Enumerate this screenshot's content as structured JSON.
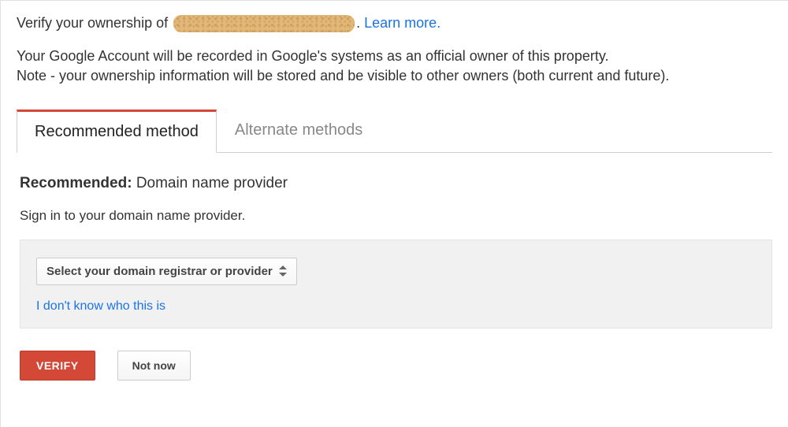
{
  "header": {
    "verify_prefix": "Verify your ownership of",
    "verify_suffix": ".",
    "learn_more": "Learn more.",
    "disclaimer_line1": "Your Google Account will be recorded in Google's systems as an official owner of this property.",
    "disclaimer_line2": "Note - your ownership information will be stored and be visible to other owners (both current and future)."
  },
  "tabs": {
    "recommended": "Recommended method",
    "alternate": "Alternate methods"
  },
  "main": {
    "recommended_label": "Recommended:",
    "method_name": "Domain name provider",
    "signin_text": "Sign in to your domain name provider.",
    "select_placeholder": "Select your domain registrar or provider",
    "dont_know": "I don't know who this is"
  },
  "buttons": {
    "verify": "VERIFY",
    "not_now": "Not now"
  }
}
